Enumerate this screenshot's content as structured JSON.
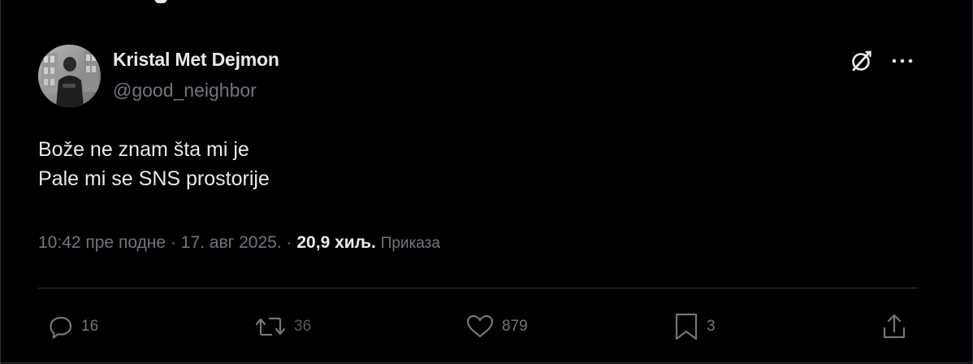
{
  "author": {
    "display_name": "Kristal Met Dejmon",
    "handle": "@good_neighbor",
    "avatar": "profile-photo"
  },
  "tweet": {
    "text_lines": [
      "Bože ne znam šta mi je",
      "Pale mi se SNS prostorije"
    ]
  },
  "meta": {
    "time": "10:42 пре подне",
    "separator": "·",
    "date": "17. авг 2025.",
    "views_count": "20,9 хиљ.",
    "views_label": "Приказа"
  },
  "actions": {
    "replies": "16",
    "reposts": "36",
    "likes": "879",
    "bookmarks": "3"
  },
  "icons": {
    "grok": "grok-icon",
    "more": "more-icon",
    "reply": "reply-icon",
    "repost": "repost-icon",
    "like": "heart-icon",
    "bookmark": "bookmark-icon",
    "share": "share-icon"
  },
  "colors": {
    "background": "#000000",
    "text_primary": "#e7e9ea",
    "text_secondary": "#71767b",
    "border": "#2f3336"
  }
}
